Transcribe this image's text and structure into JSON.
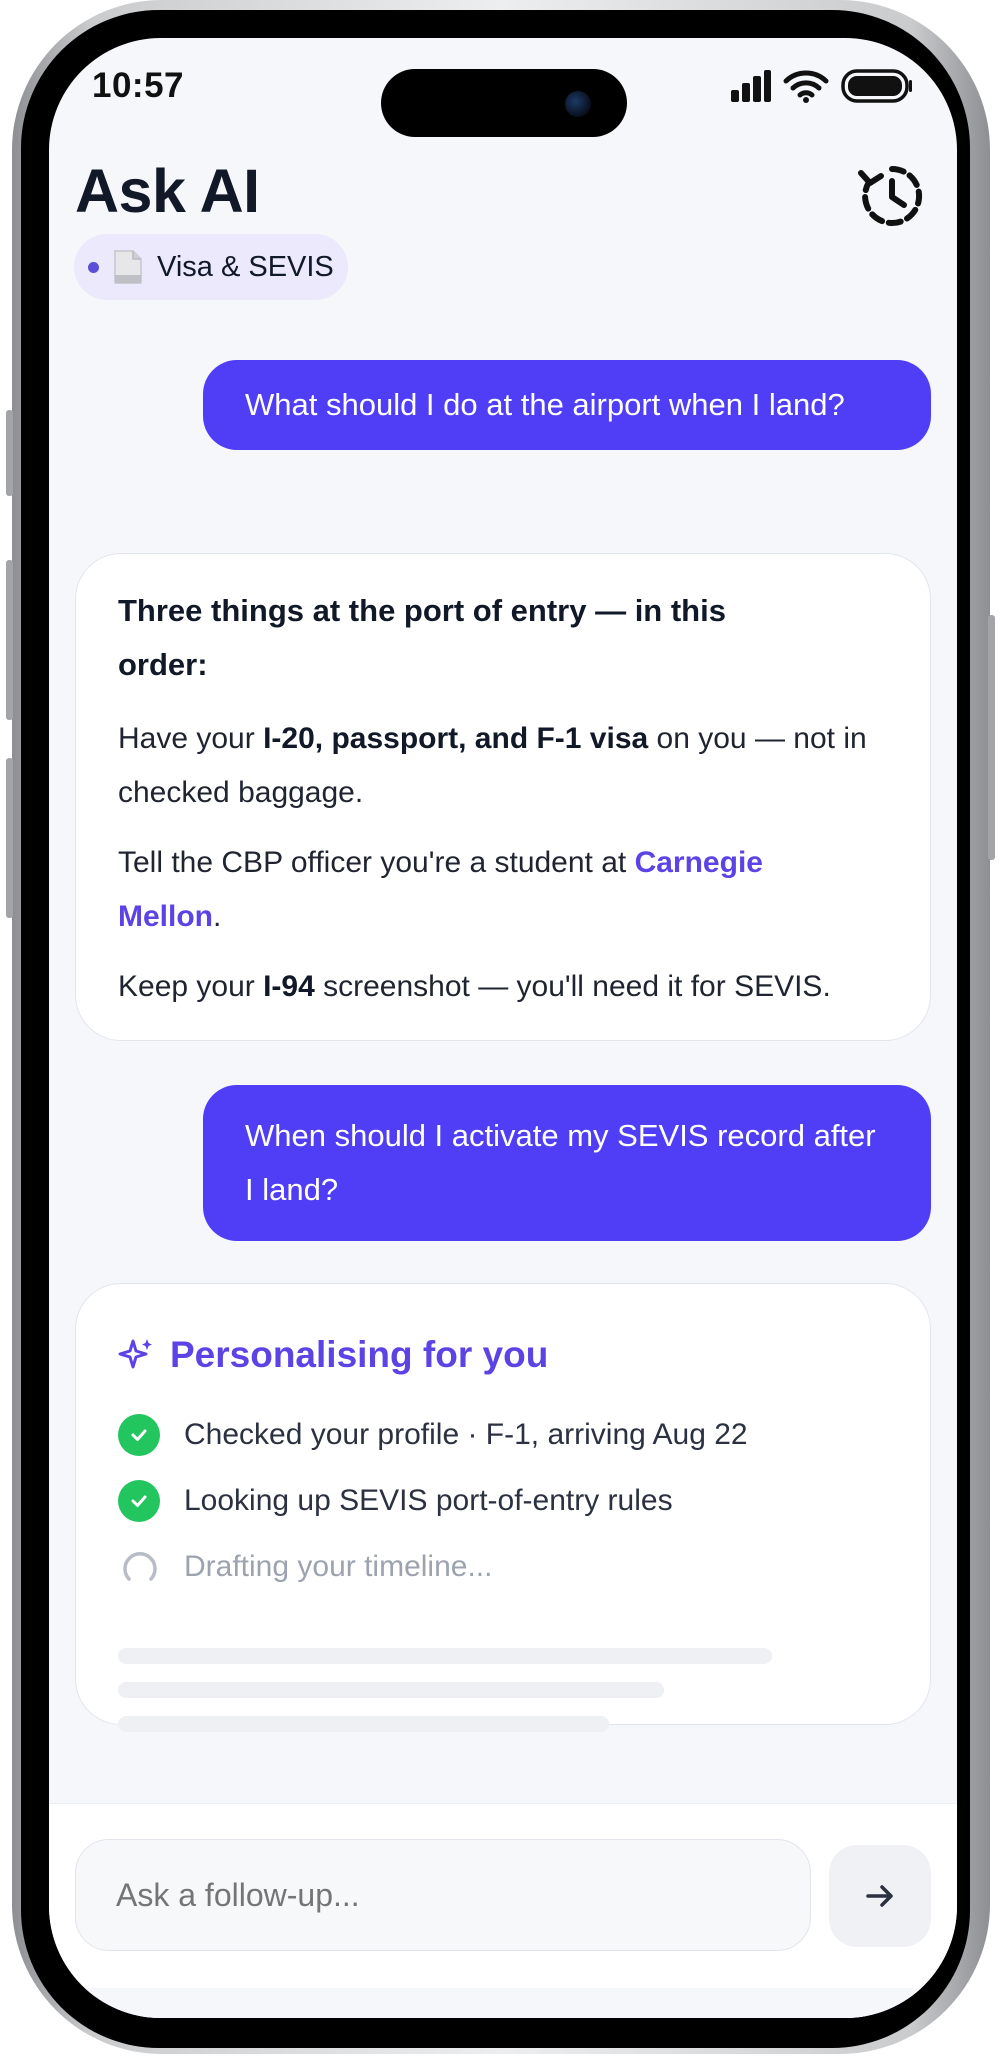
{
  "status_bar": {
    "time": "10:57"
  },
  "header": {
    "title": "Ask AI",
    "history_icon": "history-clock-icon",
    "topic_chip": {
      "icon": "document-icon",
      "label": "Visa & SEVIS"
    }
  },
  "conversation": {
    "user_message_1": "What should I do at the airport when I land?",
    "ai_response_1": {
      "heading": "Three things at the port of entry — in this order:",
      "item_1": {
        "pre": "Have your ",
        "bold": "I-20, passport, and F-1 visa",
        "post": " on you — not in checked baggage."
      },
      "item_2": {
        "pre": "Tell the CBP officer you're a student at ",
        "link": "Carnegie Mellon",
        "post": "."
      },
      "item_3": {
        "pre": "Keep your ",
        "bold": "I-94",
        "post": " screenshot — you'll need it for SEVIS."
      }
    },
    "user_message_2": "When should I activate my SEVIS record after I land?",
    "ai_progress": {
      "title": "Personalising for you",
      "steps": [
        {
          "label": "Checked your profile · F-1, arriving Aug 22",
          "status": "done"
        },
        {
          "label": "Looking up SEVIS port-of-entry rules",
          "status": "done"
        },
        {
          "label": "Drafting your timeline...",
          "status": "in-progress"
        }
      ]
    }
  },
  "composer": {
    "placeholder": "Ask a follow-up...",
    "send_icon": "arrow-right-icon"
  },
  "colors": {
    "accent": "#4f3ef5",
    "accent_text": "#5b43e6",
    "success": "#22c55e",
    "background": "#f6f7fb"
  }
}
